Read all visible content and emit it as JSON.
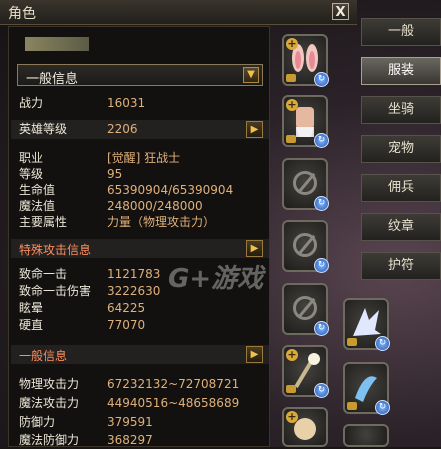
{
  "window": {
    "title": "角色",
    "close_label": "X"
  },
  "info_select": {
    "value": "一般信息"
  },
  "stats": [
    {
      "label": "战力",
      "value": "16031"
    },
    {
      "label": "英雄等级",
      "value": "2206"
    },
    {
      "label": "职业",
      "value": "[觉醒] 狂战士"
    },
    {
      "label": "等级",
      "value": "95"
    },
    {
      "label": "生命值",
      "value": "65390904/65390904"
    },
    {
      "label": "魔法值",
      "value": "248000/248000"
    },
    {
      "label": "主要属性",
      "value": "力量（物理攻击力）"
    }
  ],
  "special_section": "特殊攻击信息",
  "special_stats": [
    {
      "label": "致命一击",
      "value": "1121783"
    },
    {
      "label": "致命一击伤害",
      "value": "3222630"
    },
    {
      "label": "眩晕",
      "value": "64225"
    },
    {
      "label": "硬直",
      "value": "77070"
    }
  ],
  "general_section": "一般信息",
  "general_stats": [
    {
      "label": "物理攻击力",
      "value": "67232132~72708721"
    },
    {
      "label": "魔法攻击力",
      "value": "44940516~48658689"
    },
    {
      "label": "防御力",
      "value": "379591"
    },
    {
      "label": "魔法防御力",
      "value": "368297"
    }
  ],
  "tabs": [
    {
      "label": "一般"
    },
    {
      "label": "服装",
      "active": true
    },
    {
      "label": "坐骑"
    },
    {
      "label": "宠物"
    },
    {
      "label": "佣兵"
    },
    {
      "label": "纹章"
    },
    {
      "label": "护符"
    }
  ],
  "watermark": "G+游戏",
  "icons": {
    "plus": "plus-icon",
    "refresh": "refresh-icon",
    "empty": "empty-slot-icon",
    "arrow": "chevron-right-icon"
  }
}
